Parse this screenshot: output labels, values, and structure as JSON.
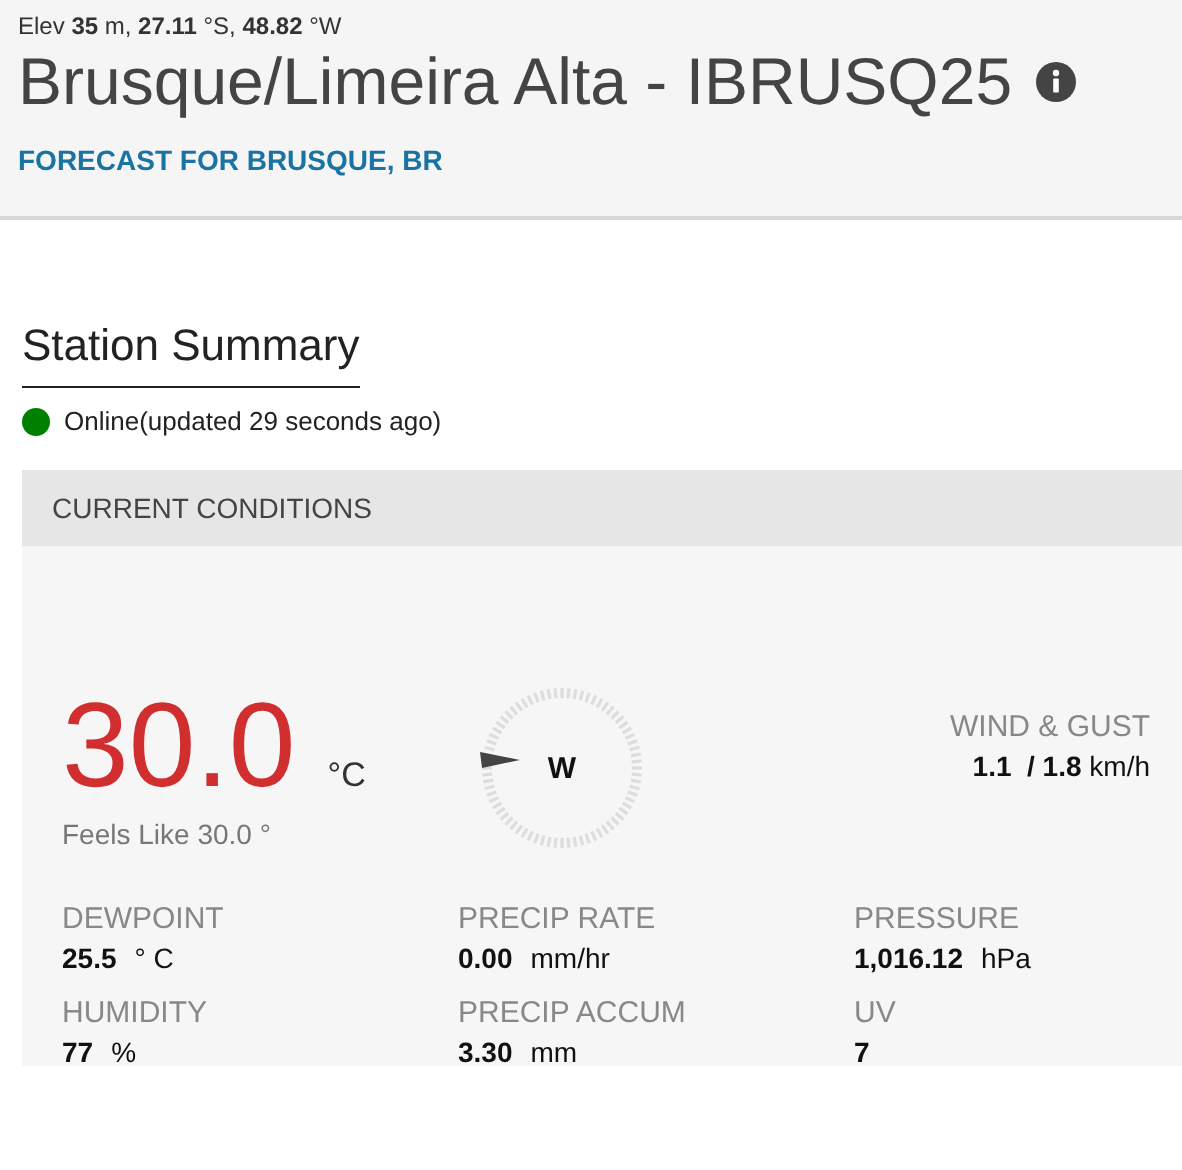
{
  "header": {
    "location_line": "Elev **35** m, **27.11** °S, **48.82** °W",
    "title": "Brusque/Limeira Alta - IBRUSQ25",
    "forecast_link": "FORECAST FOR BRUSQUE, BR"
  },
  "summary": {
    "heading": "Station Summary",
    "status": {
      "text": "Online(updated 29 seconds ago)",
      "color": "#008000"
    }
  },
  "conditions": {
    "heading": "CURRENT CONDITIONS",
    "temperature": "30.0",
    "temperature_unit": "°C",
    "feels_like": "Feels Like 30.0 °",
    "wind": {
      "direction": "W",
      "label": "WIND & GUST",
      "value": "1.1  / 1.8",
      "unit": "km/h"
    },
    "metrics": [
      {
        "label": "DEWPOINT",
        "value": "25.5",
        "unit": "° C"
      },
      {
        "label": "PRECIP RATE",
        "value": "0.00",
        "unit": "mm/hr"
      },
      {
        "label": "PRESSURE",
        "value": "1,016.12",
        "unit": "hPa"
      },
      {
        "label": "HUMIDITY",
        "value": "77",
        "unit": "%"
      },
      {
        "label": "PRECIP ACCUM",
        "value": "3.30",
        "unit": "mm"
      },
      {
        "label": "UV",
        "value": "7"
      }
    ]
  }
}
